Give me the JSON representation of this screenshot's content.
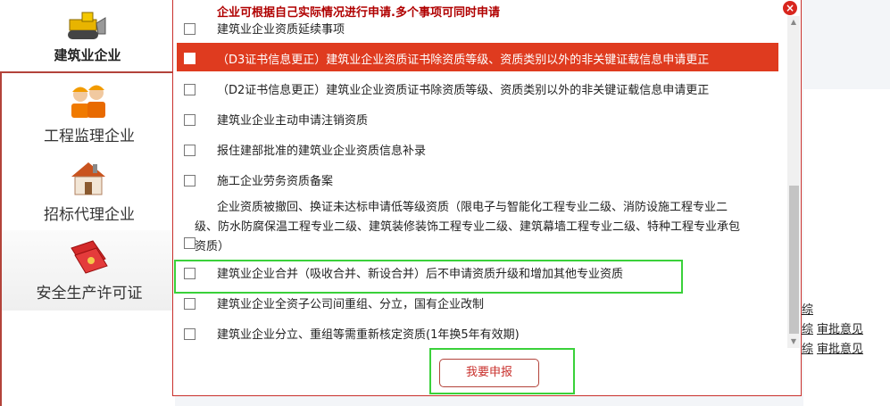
{
  "sidebar": {
    "items": [
      {
        "label": "建筑业企业",
        "icon": "bulldozer-icon"
      },
      {
        "label": "工程监理企业",
        "icon": "workers-icon"
      },
      {
        "label": "招标代理企业",
        "icon": "house-icon"
      },
      {
        "label": "安全生产许可证",
        "icon": "certificate-icon"
      }
    ]
  },
  "background": {
    "links": [
      {
        "prefix": "综",
        "link": ""
      },
      {
        "prefix": "综",
        "link": "审批意见"
      },
      {
        "prefix": "综",
        "link": "审批意见"
      }
    ]
  },
  "modal": {
    "notice": "企业可根据自己实际情况进行申请.多个事项可同时申请",
    "options": [
      "建筑业企业资质延续事项",
      "（D3证书信息更正）建筑业企业资质证书除资质等级、资质类别以外的非关键证载信息申请更正",
      "（D2证书信息更正）建筑业企业资质证书除资质等级、资质类别以外的非关键证载信息申请更正",
      "建筑业企业主动申请注销资质",
      "报住建部批准的建筑业企业资质信息补录",
      "施工企业劳务资质备案",
      "企业资质被撤回、换证未达标申请低等级资质（限电子与智能化工程专业二级、消防设施工程专业二级、防水防腐保温工程专业二级、建筑装修装饰工程专业二级、建筑幕墙工程专业二级、特种工程专业承包资质）",
      "建筑业企业合并（吸收合并、新设合并）后不申请资质升级和增加其他专业资质",
      "建筑业企业全资子公司间重组、分立，国有企业改制",
      "建筑业企业分立、重组等需重新核定资质(1年换5年有效期)"
    ],
    "highlighted_index": 1,
    "submit_label": "我要申报",
    "close_glyph": "×"
  },
  "colors": {
    "accent": "#c9302c",
    "highlight_row": "#df3b1f",
    "notice_text": "#b00000",
    "green_outline": "#3ad13a"
  }
}
